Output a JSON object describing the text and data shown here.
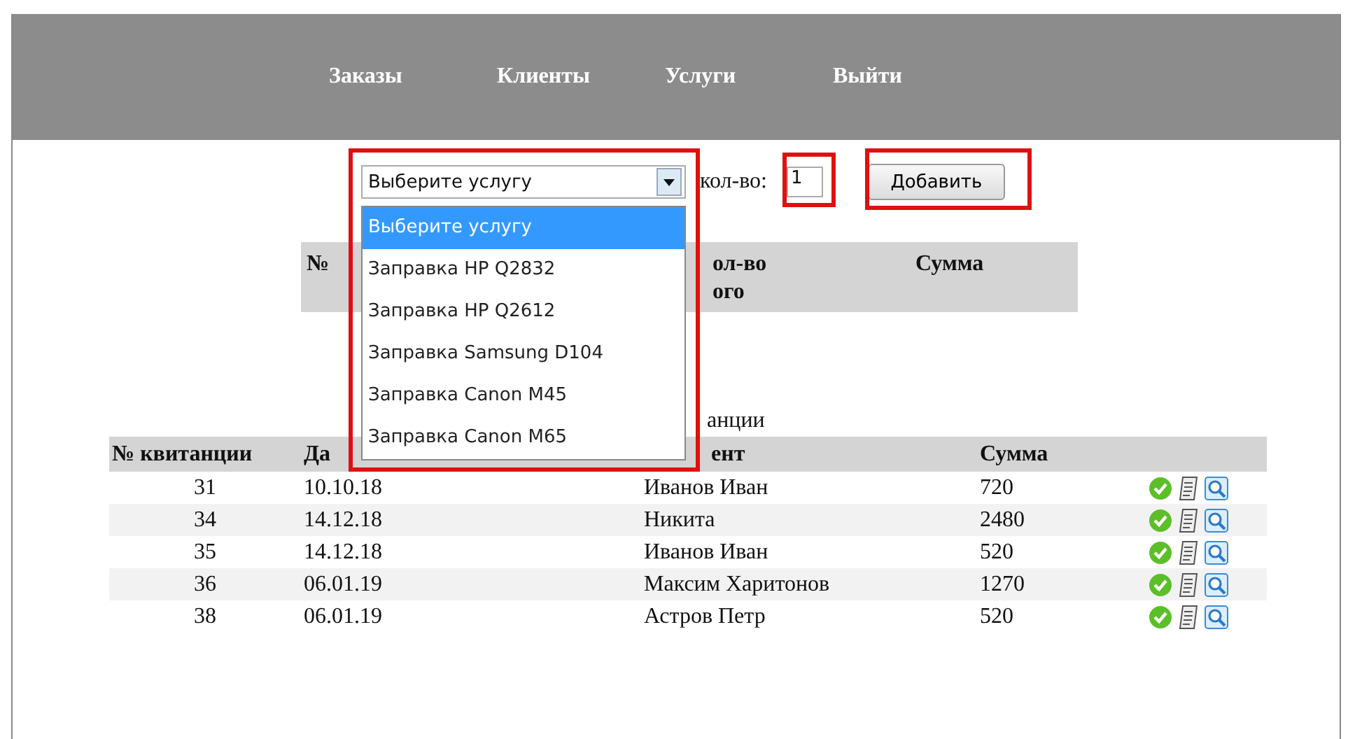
{
  "nav": [
    {
      "label": "Заказы"
    },
    {
      "label": "Клиенты"
    },
    {
      "label": "Услуги"
    },
    {
      "label": "Выйти"
    }
  ],
  "form": {
    "service_select": {
      "value": "Выберите услугу",
      "expanded": true,
      "options": [
        {
          "label": "Выберите услугу",
          "selected": true
        },
        {
          "label": "Заправка HP Q2832",
          "selected": false
        },
        {
          "label": "Заправка HP Q2612",
          "selected": false
        },
        {
          "label": "Заправка Samsung D104",
          "selected": false
        },
        {
          "label": "Заправка Canon M45",
          "selected": false
        },
        {
          "label": "Заправка Canon M65",
          "selected": false
        }
      ]
    },
    "quantity_label": "кол-во:",
    "quantity": "1",
    "add_button": "Добавить"
  },
  "order_table": {
    "columns": [
      {
        "lines": [
          "№"
        ]
      },
      {
        "lines": [
          "ол-во",
          "ого"
        ]
      },
      {
        "lines": [
          "Сумма"
        ]
      }
    ]
  },
  "receipts": {
    "title": "анции",
    "columns": [
      "№ квитанции",
      "Да",
      "ент",
      "Сумма"
    ],
    "rows": [
      {
        "cells": [
          "31",
          "10.10.18",
          "Иванов Иван",
          "720"
        ]
      },
      {
        "cells": [
          "34",
          "14.12.18",
          "Никита",
          "2480"
        ]
      },
      {
        "cells": [
          "35",
          "14.12.18",
          "Иванов Иван",
          "520"
        ]
      },
      {
        "cells": [
          "36",
          "06.01.19",
          "Максим Харитонов",
          "1270"
        ]
      },
      {
        "cells": [
          "38",
          "06.01.19",
          "Астров Петр",
          "520"
        ]
      }
    ]
  }
}
